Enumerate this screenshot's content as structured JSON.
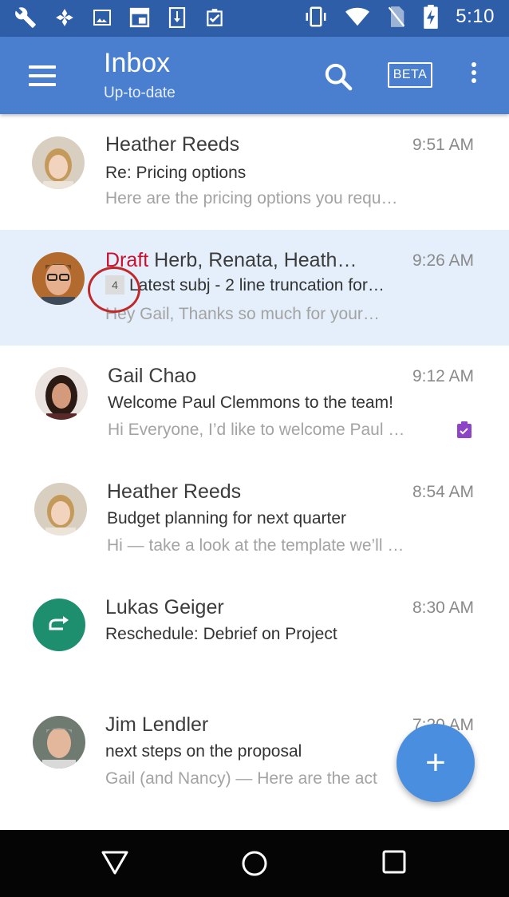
{
  "status_bar": {
    "time": "5:10",
    "icons": [
      "wrench-icon",
      "pinwheel-icon",
      "image-icon",
      "window-icon",
      "download-icon",
      "clipboard-check-icon",
      "vibrate-icon",
      "wifi-icon",
      "no-sim-icon",
      "battery-charging-icon"
    ]
  },
  "app_bar": {
    "title": "Inbox",
    "subtitle": "Up-to-date",
    "beta_label": "BETA",
    "icons": [
      "menu-icon",
      "search-icon",
      "more-vert-icon"
    ]
  },
  "messages": [
    {
      "sender": "Heather Reeds",
      "time": "9:51 AM",
      "subject": "Re: Pricing options",
      "preview": "Here are the pricing options you requ…"
    },
    {
      "draft_label": "Draft",
      "sender": "Herb, Renata, Heath…",
      "time": "9:26 AM",
      "thread_count": "4",
      "subject": "Latest subj - 2 line truncation for…",
      "preview": "Hey Gail, Thanks so much for your…",
      "selected": true,
      "accent_icon": "clipboard-check-icon",
      "accent_color": "#8e44c7"
    },
    {
      "sender": "Gail Chao",
      "time": "9:12 AM",
      "subject": "Welcome Paul Clemmons to the team!",
      "preview": "Hi Everyone, I’d like to welcome Paul …"
    },
    {
      "sender": "Heather Reeds",
      "time": "8:54 AM",
      "subject": "Budget planning for next quarter",
      "preview": "Hi — take a look at the template we’ll …"
    },
    {
      "sender": "Lukas Geiger",
      "time": "8:30 AM",
      "subject": "Reschedule: Debrief on Project",
      "avatar_icon": "reschedule-icon",
      "avatar_color": "#1e8f6e"
    },
    {
      "sender": "Jim Lendler",
      "time": "7:20 AM",
      "subject": "next steps on the proposal",
      "preview": "Gail (and Nancy) — Here are the act"
    }
  ],
  "fab": {
    "label": "+",
    "icon": "compose-plus-icon",
    "color": "#4a8ee0"
  },
  "nav_bar": {
    "icons": [
      "back-icon",
      "home-icon",
      "recents-icon"
    ]
  },
  "colors": {
    "status_bar": "#2f5ea8",
    "app_bar": "#4a7fd0",
    "selected_row": "#e4effb",
    "draft": "#c8102e"
  }
}
